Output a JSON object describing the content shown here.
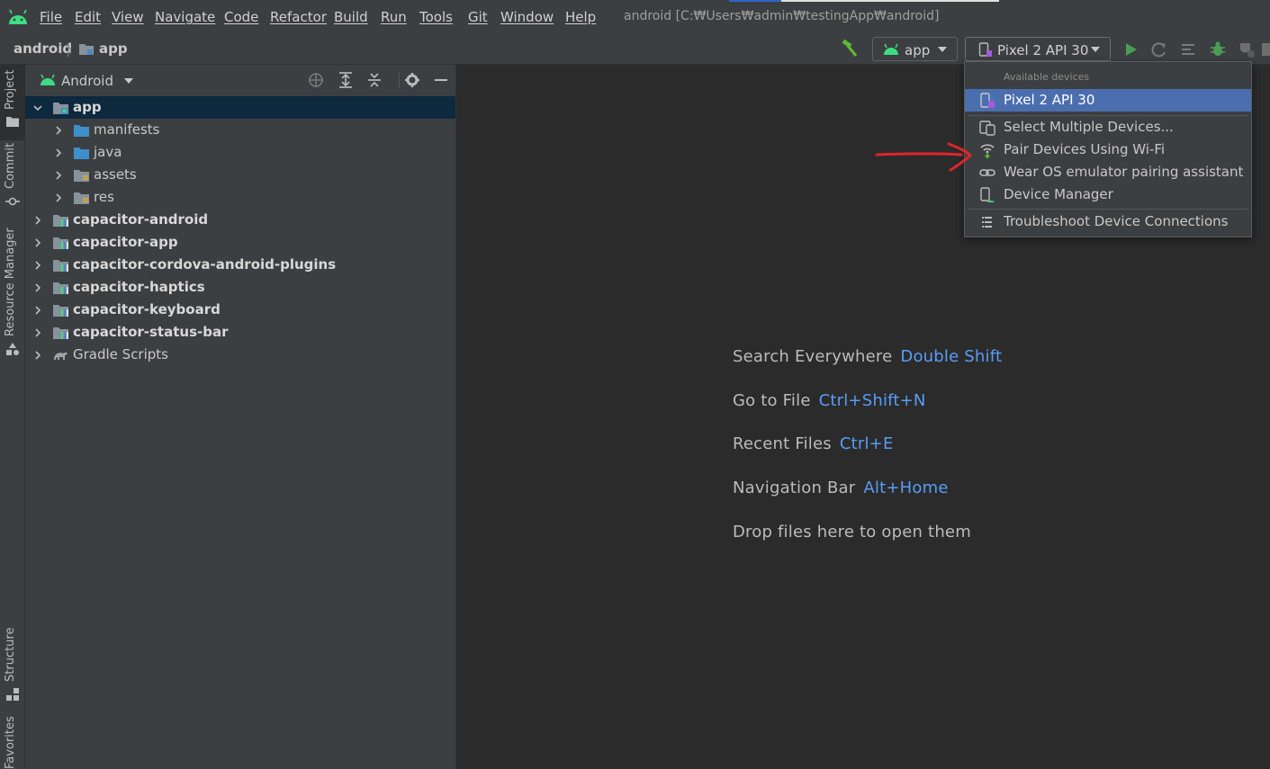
{
  "menubar": {
    "items": [
      "File",
      "Edit",
      "View",
      "Navigate",
      "Code",
      "Refactor",
      "Build",
      "Run",
      "Tools",
      "Git",
      "Window",
      "Help"
    ],
    "title": "android [C:₩Users₩admin₩testingApp₩android]"
  },
  "navbar": {
    "breadcrumb_root": "android",
    "breadcrumb_module": "app",
    "run_config": "app",
    "device": "Pixel 2 API 30"
  },
  "left_strip": {
    "tabs": [
      "Project",
      "Commit",
      "Resource Manager",
      "Structure",
      "Favorites"
    ]
  },
  "project_panel": {
    "view_mode": "Android",
    "tree": [
      {
        "label": "app",
        "level": 0,
        "expanded": true,
        "selected": true,
        "bold": true,
        "icon": "module-folder-icon"
      },
      {
        "label": "manifests",
        "level": 1,
        "expanded": false,
        "icon": "folder-icon"
      },
      {
        "label": "java",
        "level": 1,
        "expanded": false,
        "icon": "folder-icon"
      },
      {
        "label": "assets",
        "level": 1,
        "expanded": false,
        "icon": "resource-folder-icon"
      },
      {
        "label": "res",
        "level": 1,
        "expanded": false,
        "icon": "resource-folder-icon"
      },
      {
        "label": "capacitor-android",
        "level": 0,
        "expanded": false,
        "bold": true,
        "icon": "library-module-icon"
      },
      {
        "label": "capacitor-app",
        "level": 0,
        "expanded": false,
        "bold": true,
        "icon": "library-module-icon"
      },
      {
        "label": "capacitor-cordova-android-plugins",
        "level": 0,
        "expanded": false,
        "bold": true,
        "icon": "library-module-icon"
      },
      {
        "label": "capacitor-haptics",
        "level": 0,
        "expanded": false,
        "bold": true,
        "icon": "library-module-icon"
      },
      {
        "label": "capacitor-keyboard",
        "level": 0,
        "expanded": false,
        "bold": true,
        "icon": "library-module-icon"
      },
      {
        "label": "capacitor-status-bar",
        "level": 0,
        "expanded": false,
        "bold": true,
        "icon": "library-module-icon"
      },
      {
        "label": "Gradle Scripts",
        "level": 0,
        "expanded": false,
        "bold": false,
        "icon": "gradle-icon"
      }
    ]
  },
  "editor": {
    "hints": [
      {
        "label": "Search Everywhere",
        "key": "Double Shift"
      },
      {
        "label": "Go to File",
        "key": "Ctrl+Shift+N"
      },
      {
        "label": "Recent Files",
        "key": "Ctrl+E"
      },
      {
        "label": "Navigation Bar",
        "key": "Alt+Home"
      },
      {
        "label": "Drop files here to open them",
        "key": ""
      }
    ]
  },
  "device_dropdown": {
    "section_label": "Available devices",
    "items": [
      {
        "label": "Pixel 2 API 30",
        "icon": "phone-device-icon",
        "selected": true
      },
      {
        "label": "Select Multiple Devices...",
        "icon": "multiple-devices-icon"
      },
      {
        "label": "Pair Devices Using Wi-Fi",
        "icon": "wifi-pair-icon"
      },
      {
        "label": "Wear OS emulator pairing assistant",
        "icon": "link-icon"
      },
      {
        "label": "Device Manager",
        "icon": "device-manager-icon"
      },
      {
        "label": "Troubleshoot Device Connections",
        "icon": "list-icon"
      }
    ]
  },
  "colors": {
    "accent_blue": "#589df6",
    "selection": "#4b6eaf",
    "android_green": "#3ddc84",
    "annotation_red": "#e0252a"
  }
}
